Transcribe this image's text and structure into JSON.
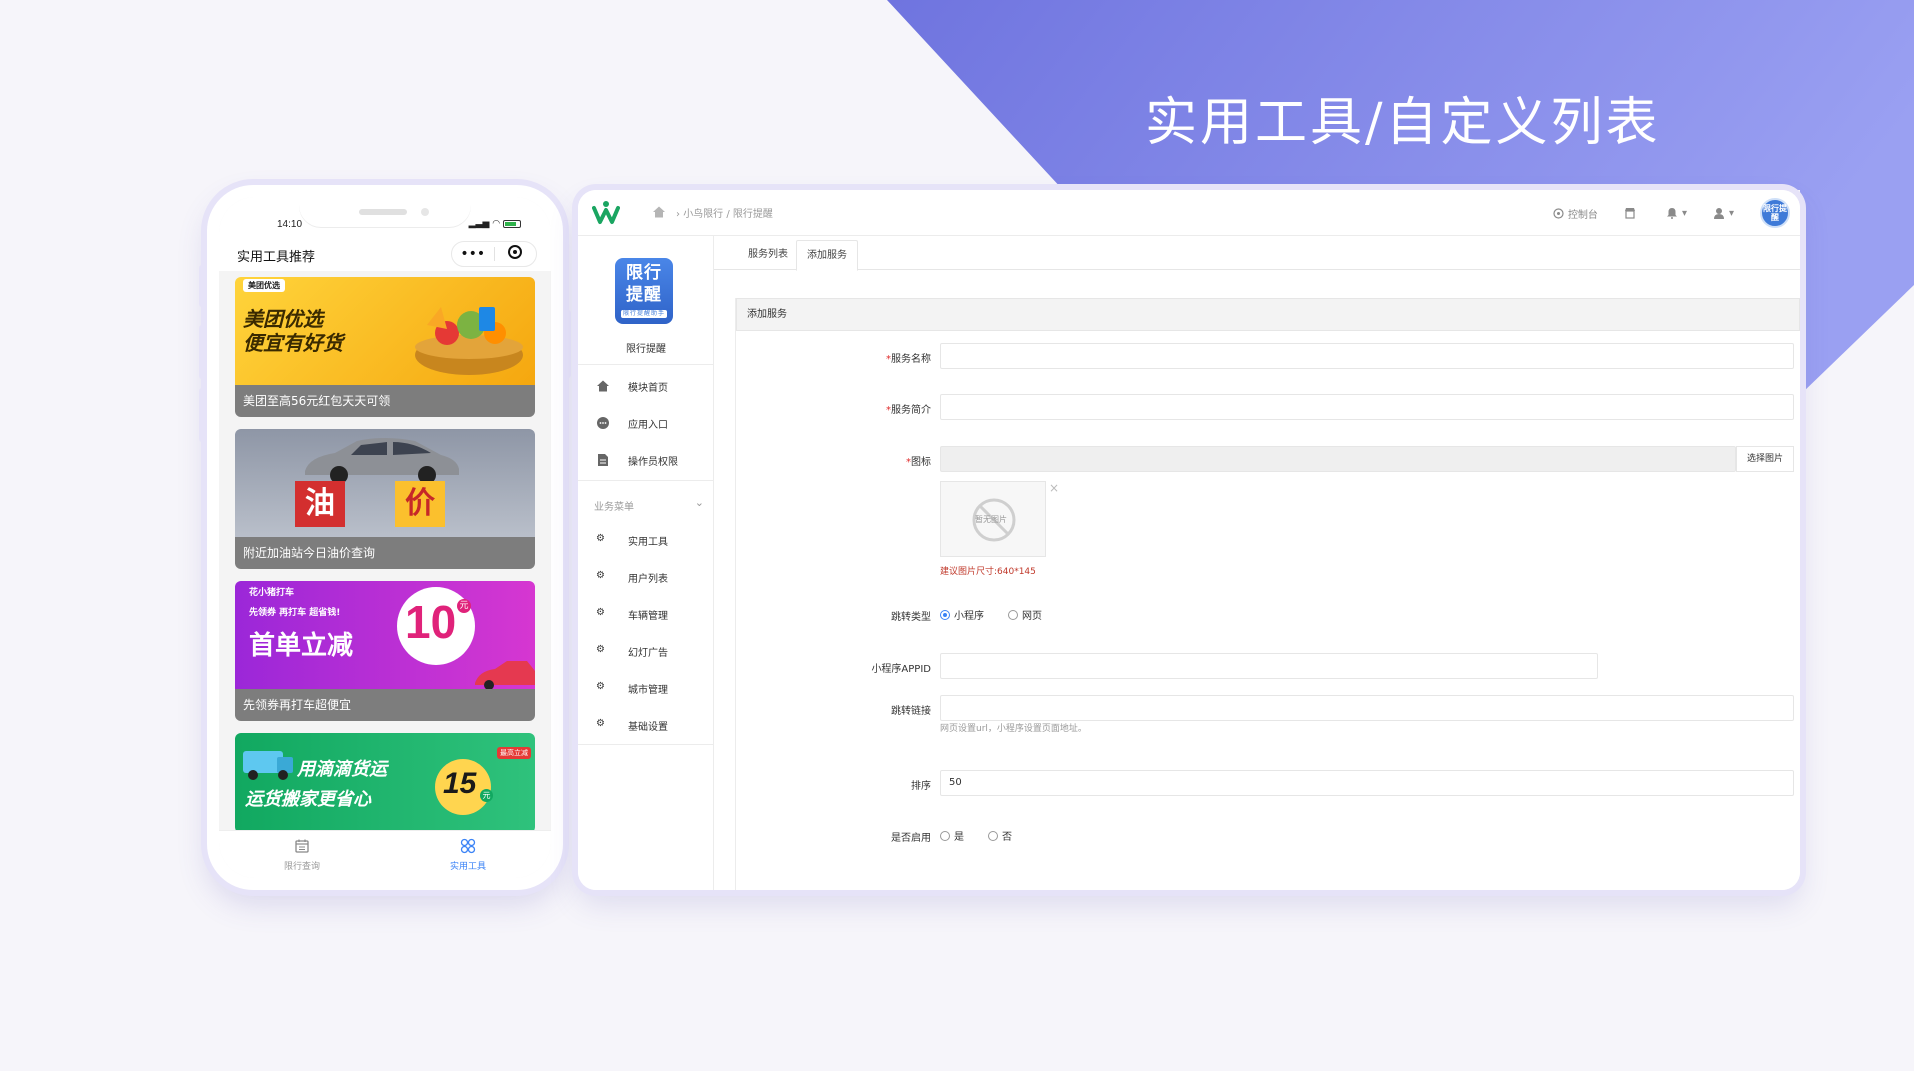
{
  "slide": {
    "title": "实用工具/自定义列表"
  },
  "colors": {
    "accent": "#7b82e6",
    "primary": "#3b83f6",
    "required": "#e02b2b"
  },
  "phone": {
    "time": "14:10",
    "header_title": "实用工具推荐",
    "capsule": {
      "more": "•••",
      "close_icon": "target-icon"
    },
    "cards": [
      {
        "banner_badge": "美团优选",
        "banner_line1": "美团优选",
        "banner_line2": "便宜有好货",
        "caption": "美团至高56元红包天天可领"
      },
      {
        "banner_word1": "油",
        "banner_word2": "价",
        "caption": "附近加油站今日油价查询"
      },
      {
        "banner_badge": "花小猪打车",
        "banner_line1": "先领券 再打车 超省钱!",
        "banner_line2": "首单立减",
        "banner_num": "10",
        "banner_unit": "元",
        "caption": "先领券再打车超便宜"
      },
      {
        "banner_line1": "用滴滴货运",
        "banner_line2": "运货搬家更省心",
        "banner_num": "15",
        "banner_unit": "元",
        "banner_tag": "最高立减"
      }
    ],
    "tabbar": [
      {
        "label": "限行查询",
        "icon": "calendar-icon",
        "active": false
      },
      {
        "label": "实用工具",
        "icon": "grid-icon",
        "active": true
      }
    ]
  },
  "admin": {
    "breadcrumb": "小鸟限行 / 限行提醒",
    "topbar": {
      "console": "控制台"
    },
    "avatar_text": "限行提醒",
    "sidebar": {
      "logo_line1": "限行",
      "logo_line2": "提醒",
      "logo_sub": "限行提醒助手",
      "app_name": "限行提醒",
      "items": [
        {
          "label": "模块首页",
          "icon": "home-icon"
        },
        {
          "label": "应用入口",
          "icon": "chat-icon"
        },
        {
          "label": "操作员权限",
          "icon": "doc-icon"
        }
      ],
      "group_label": "业务菜单",
      "group_items": [
        {
          "label": "实用工具",
          "icon": "gear-icon"
        },
        {
          "label": "用户列表",
          "icon": "gear-icon"
        },
        {
          "label": "车辆管理",
          "icon": "gear-icon"
        },
        {
          "label": "幻灯广告",
          "icon": "gear-icon"
        },
        {
          "label": "城市管理",
          "icon": "gear-icon"
        },
        {
          "label": "基础设置",
          "icon": "gear-icon"
        }
      ]
    },
    "tabs": [
      {
        "label": "服务列表",
        "active": false
      },
      {
        "label": "添加服务",
        "active": true
      }
    ],
    "panel_title": "添加服务",
    "form": {
      "name_label": "服务名称",
      "name_value": "",
      "intro_label": "服务简介",
      "intro_value": "",
      "icon_label": "图标",
      "pick_button": "选择图片",
      "no_image_text": "暂无图片",
      "close_mark": "×",
      "size_hint": "建议图片尺寸:640*145",
      "jump_type_label": "跳转类型",
      "jump_type_options": [
        "小程序",
        "网页"
      ],
      "jump_type_selected": "小程序",
      "appid_label": "小程序APPID",
      "appid_value": "",
      "link_label": "跳转链接",
      "link_value": "",
      "link_hint": "网页设置url，小程序设置页面地址。",
      "sort_label": "排序",
      "sort_value": "50",
      "enable_label": "是否启用",
      "enable_options": [
        "是",
        "否"
      ],
      "enable_selected": ""
    }
  }
}
